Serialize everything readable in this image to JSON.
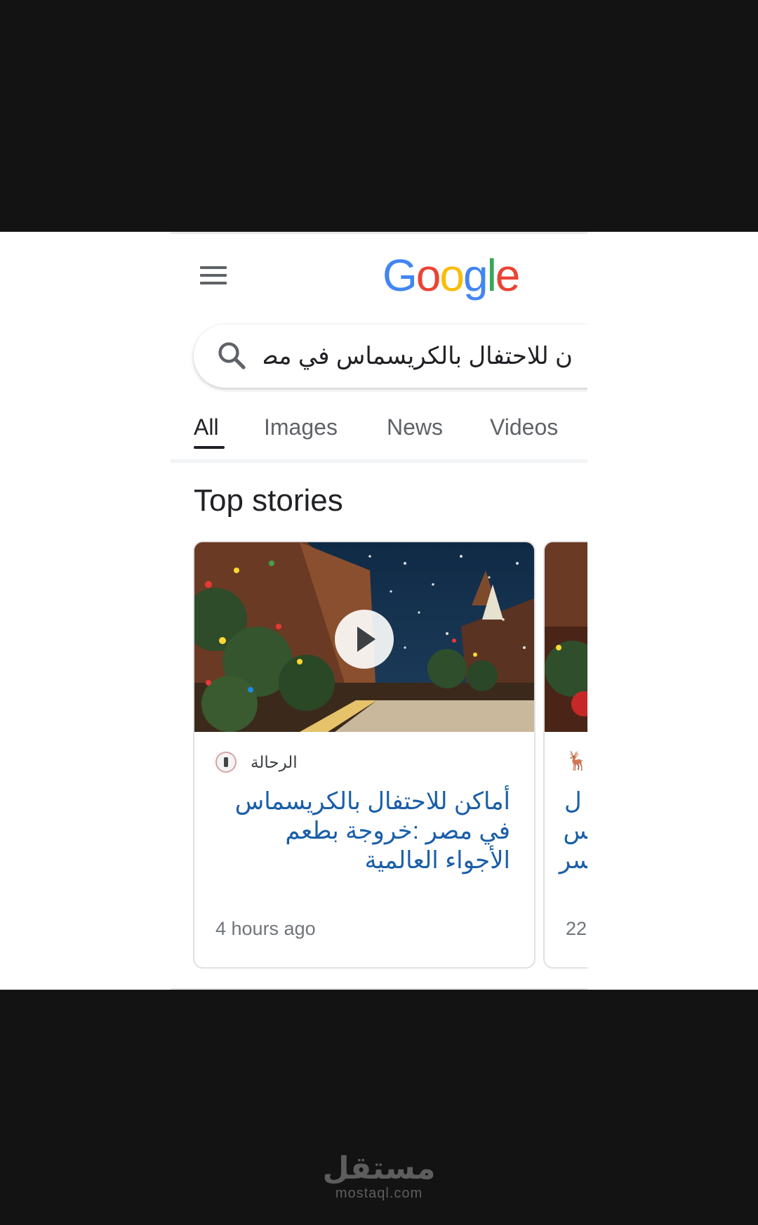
{
  "header": {
    "menu_icon": "hamburger-menu-icon",
    "logo_letters": [
      {
        "char": "G",
        "color": "#4285F4"
      },
      {
        "char": "o",
        "color": "#EA4335"
      },
      {
        "char": "o",
        "color": "#FBBC05"
      },
      {
        "char": "g",
        "color": "#4285F4"
      },
      {
        "char": "l",
        "color": "#34A853"
      },
      {
        "char": "e",
        "color": "#EA4335"
      }
    ]
  },
  "search": {
    "query": "ن للاحتفال بالكريسماس في مصر",
    "icon": "search-icon"
  },
  "tabs": [
    {
      "label": "All",
      "active": true
    },
    {
      "label": "Images",
      "active": false
    },
    {
      "label": "News",
      "active": false
    },
    {
      "label": "Videos",
      "active": false
    }
  ],
  "section": {
    "title": "Top stories"
  },
  "stories": [
    {
      "source": "الرحالة",
      "headline": "أماكن للاحتفال بالكريسماس في مصر :خروجة بطعم الأجواء العالمية",
      "time": "4 hours ago",
      "has_video": true
    },
    {
      "source_icon": "reindeer-logo-icon",
      "headline_fragment": "ل\nس\nسر",
      "time": "22"
    }
  ],
  "watermark": {
    "arabic": "مستقل",
    "latin": "mostaql.com"
  }
}
